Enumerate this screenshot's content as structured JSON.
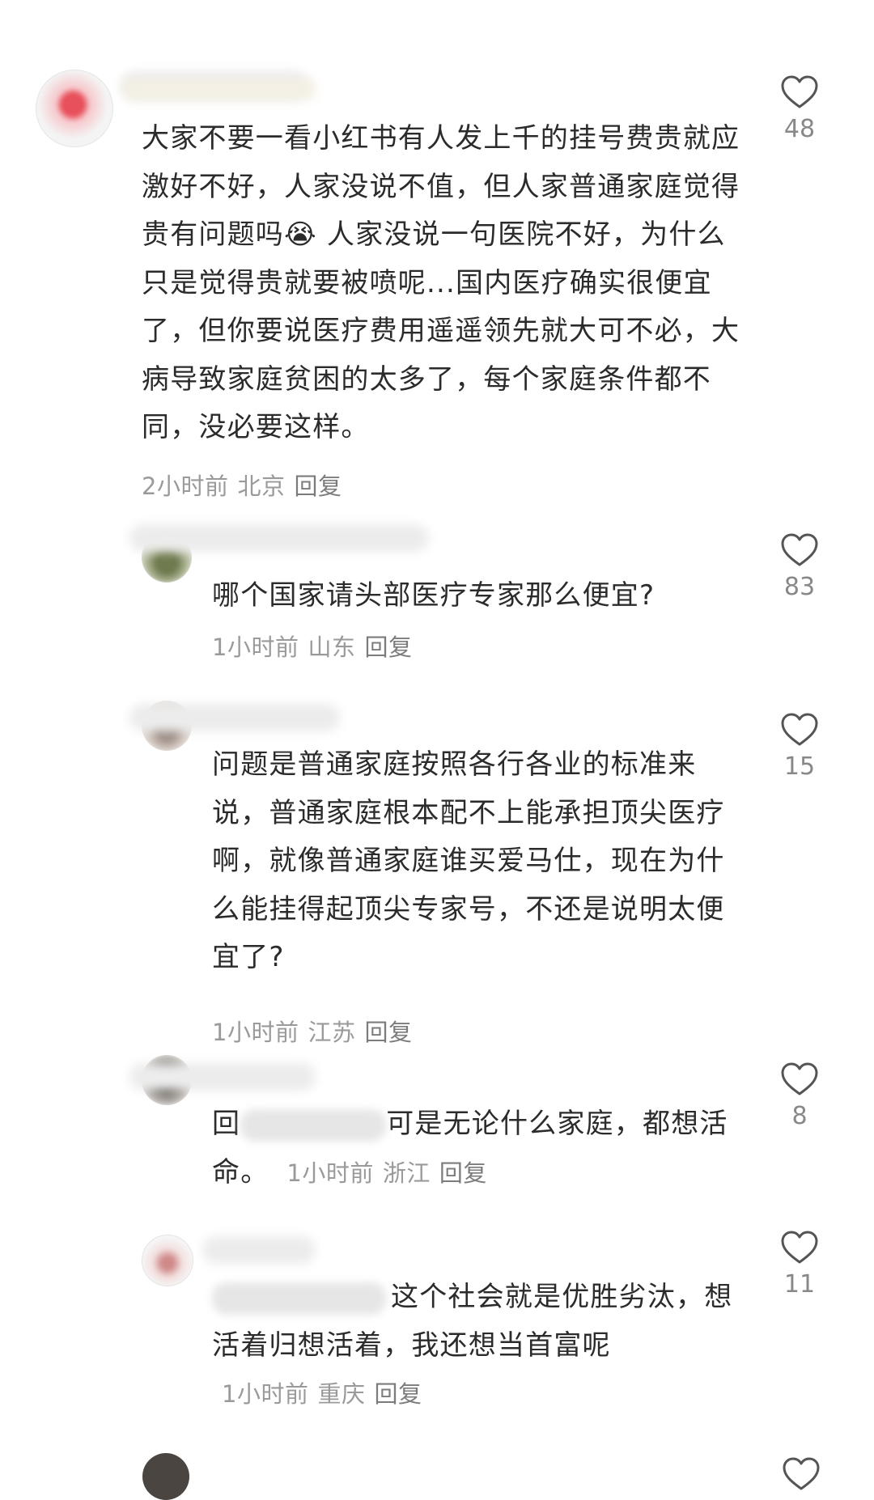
{
  "comments": [
    {
      "text": "大家不要一看小红书有人发上千的挂号费贵就应激好不好，人家没说不值，但人家普通家庭觉得贵有问题吗😭 人家没说一句医院不好，为什么只是觉得贵就要被喷呢...国内医疗确实很便宜了，但你要说医疗费用遥遥领先就大可不必，大病导致家庭贫困的太多了，每个家庭条件都不同，没必要这样。",
      "time": "2小时前",
      "location": "北京",
      "reply": "回复",
      "likes": "48"
    },
    {
      "text": "哪个国家请头部医疗专家那么便宜?",
      "time": "1小时前",
      "location": "山东",
      "reply": "回复",
      "likes": "83"
    },
    {
      "text": "问题是普通家庭按照各行各业的标准来说，普通家庭根本配不上能承担顶尖医疗啊，就像普通家庭谁买爱马仕，现在为什么能挂得起顶尖专家号，不还是说明太便宜了?",
      "time": "1小时前",
      "location": "江苏",
      "reply": "回复",
      "likes": "15"
    },
    {
      "prefix": "回",
      "text": "可是无论什么家庭，都想活命。",
      "time": "1小时前",
      "location": "浙江",
      "reply": "回复",
      "likes": "8"
    },
    {
      "text": "这个社会就是优胜劣汰，想活着归想活着，我还想当首富呢",
      "time": "1小时前",
      "location": "重庆",
      "reply": "回复",
      "likes": "11"
    }
  ],
  "icons": {
    "like": "heart-outline-icon",
    "avatar": "user-avatar"
  },
  "colors": {
    "text": "#2b2b2b",
    "meta": "#9a9a9a",
    "heart": "#555555"
  }
}
